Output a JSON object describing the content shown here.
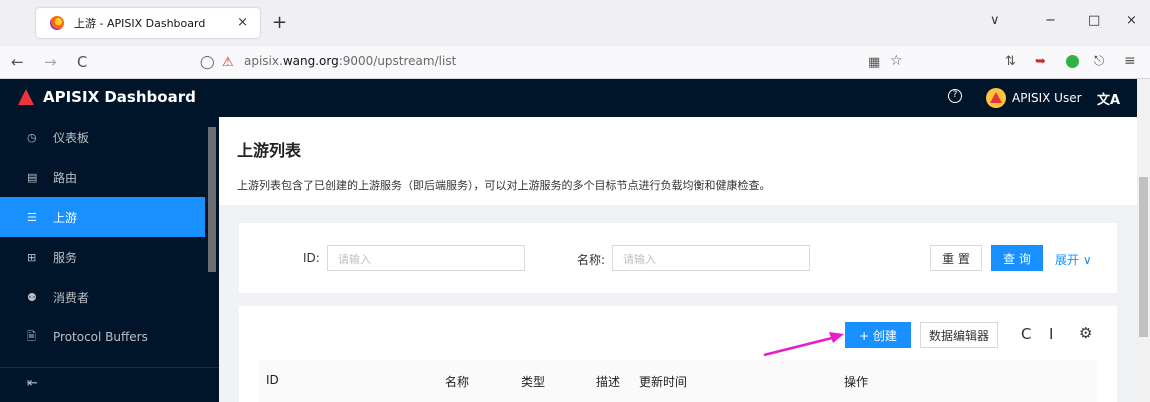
{
  "browser": {
    "tab_title": "上游 - APISIX Dashboard",
    "tab_close": "×",
    "new_tab": "+",
    "url_prefix": "apisix.",
    "url_host": "wang.org",
    "url_rest": ":9000/upstream/list",
    "nav_back": "←",
    "nav_forward": "→",
    "nav_reload": "C",
    "nav_shield": "◯",
    "win_min": "−",
    "win_max": "□",
    "win_close": "×",
    "win_chevron": "∨"
  },
  "header": {
    "brand": "APISIX Dashboard",
    "help": "?",
    "user": "APISIX User",
    "lang": "文A"
  },
  "sidebar": {
    "items": [
      {
        "icon": "◷",
        "label": "仪表板"
      },
      {
        "icon": "▤",
        "label": "路由"
      },
      {
        "icon": "☰",
        "label": "上游"
      },
      {
        "icon": "⊞",
        "label": "服务"
      },
      {
        "icon": "⚉",
        "label": "消费者"
      },
      {
        "icon": "🗎",
        "label": "Protocol Buffers"
      }
    ],
    "active_index": 2,
    "collapse": "⇤"
  },
  "page": {
    "title": "上游列表",
    "description": "上游列表包含了已创建的上游服务（即后端服务），可以对上游服务的多个目标节点进行负载均衡和健康检查。"
  },
  "search": {
    "id_label": "ID:",
    "id_placeholder": "请输入",
    "name_label": "名称:",
    "name_placeholder": "请输入",
    "reset": "重 置",
    "query": "查 询",
    "expand": "展开 ∨"
  },
  "toolbar": {
    "create": "+ 创建",
    "data_editor": "数据编辑器",
    "reload_icon": "C",
    "density_icon": "Ⅰ",
    "settings_icon": "⚙"
  },
  "table": {
    "columns": [
      "ID",
      "名称",
      "类型",
      "描述",
      "更新时间",
      "操作"
    ]
  },
  "colors": {
    "primary": "#1890ff",
    "dark": "#001529",
    "annotation": "#e91ec8"
  }
}
